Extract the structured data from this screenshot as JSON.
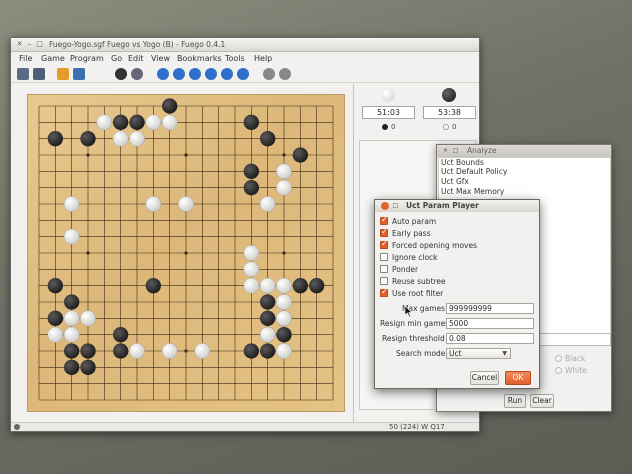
{
  "main_window": {
    "title": "Fuego-Yogo.sgf Fuego vs Yogo (B) - Fuego 0.4.1",
    "menu": [
      "File",
      "Game",
      "Program",
      "Go",
      "Edit",
      "View",
      "Bookmarks",
      "Tools",
      "Help"
    ],
    "toolbar_icons": [
      "open-icon",
      "save-icon",
      "new-game-icon",
      "setup-icon",
      "computer-icon",
      "beginning-icon",
      "back-ten-icon",
      "back-icon",
      "forward-icon",
      "forward-ten-icon",
      "end-icon",
      "pass-icon",
      "interrupt-icon"
    ],
    "black_clock": "51:03",
    "white_clock": "53:38",
    "black_captures": "0",
    "white_captures": "0",
    "status": "50 (224) W Q17"
  },
  "board": {
    "size": 19,
    "black_stones": [
      [
        8,
        0
      ],
      [
        5,
        1
      ],
      [
        6,
        1
      ],
      [
        13,
        1
      ],
      [
        1,
        2
      ],
      [
        3,
        2
      ],
      [
        14,
        2
      ],
      [
        16,
        3
      ],
      [
        13,
        4
      ],
      [
        15,
        4
      ],
      [
        13,
        5
      ],
      [
        1,
        11
      ],
      [
        7,
        11
      ],
      [
        16,
        11
      ],
      [
        17,
        11
      ],
      [
        2,
        12
      ],
      [
        14,
        12
      ],
      [
        1,
        13
      ],
      [
        5,
        14
      ],
      [
        14,
        13
      ],
      [
        15,
        13
      ],
      [
        2,
        15
      ],
      [
        3,
        15
      ],
      [
        14,
        14
      ],
      [
        15,
        14
      ],
      [
        5,
        15
      ],
      [
        13,
        15
      ],
      [
        2,
        16
      ],
      [
        3,
        16
      ],
      [
        14,
        15
      ]
    ],
    "white_stones": [
      [
        8,
        1
      ],
      [
        4,
        1
      ],
      [
        7,
        1
      ],
      [
        5,
        2
      ],
      [
        6,
        2
      ],
      [
        15,
        4
      ],
      [
        15,
        5
      ],
      [
        14,
        6
      ],
      [
        2,
        6
      ],
      [
        7,
        6
      ],
      [
        9,
        6
      ],
      [
        2,
        8
      ],
      [
        13,
        9
      ],
      [
        13,
        10
      ],
      [
        13,
        11
      ],
      [
        14,
        11
      ],
      [
        15,
        11
      ],
      [
        15,
        12
      ],
      [
        15,
        13
      ],
      [
        2,
        13
      ],
      [
        3,
        13
      ],
      [
        1,
        14
      ],
      [
        2,
        14
      ],
      [
        6,
        15
      ],
      [
        8,
        15
      ],
      [
        10,
        15
      ],
      [
        14,
        14
      ],
      [
        15,
        15
      ]
    ],
    "star_points": [
      [
        3,
        3
      ],
      [
        9,
        3
      ],
      [
        15,
        3
      ],
      [
        3,
        9
      ],
      [
        9,
        9
      ],
      [
        15,
        9
      ],
      [
        3,
        15
      ],
      [
        9,
        15
      ],
      [
        15,
        15
      ]
    ]
  },
  "analyze": {
    "title": "Analyze",
    "commands": [
      "Uct Bounds",
      "Uct Default Policy",
      "Uct Gfx",
      "Uct Max Memory"
    ],
    "radio_black": "Black",
    "radio_white": "White",
    "run_label": "Run",
    "clear_label": "Clear"
  },
  "param_dialog": {
    "title": "Uct Param Player",
    "checks": [
      {
        "label": "Auto param",
        "checked": true
      },
      {
        "label": "Early pass",
        "checked": true
      },
      {
        "label": "Forced opening moves",
        "checked": true
      },
      {
        "label": "Ignore clock",
        "checked": false
      },
      {
        "label": "Ponder",
        "checked": false
      },
      {
        "label": "Reuse subtree",
        "checked": false
      },
      {
        "label": "Use root filter",
        "checked": true
      }
    ],
    "max_games_label": "Max games",
    "max_games_value": "999999999",
    "resign_min_games_label": "Resign min games",
    "resign_min_games_value": "5000",
    "resign_threshold_label": "Resign threshold",
    "resign_threshold_value": "0.08",
    "search_mode_label": "Search mode",
    "search_mode_value": "Uct",
    "cancel_label": "Cancel",
    "ok_label": "OK"
  },
  "colors": {
    "accent": "#e0612c",
    "board": "#dcb779",
    "black_stone": "#1f1f1f",
    "white_stone": "#f4f4f2"
  }
}
